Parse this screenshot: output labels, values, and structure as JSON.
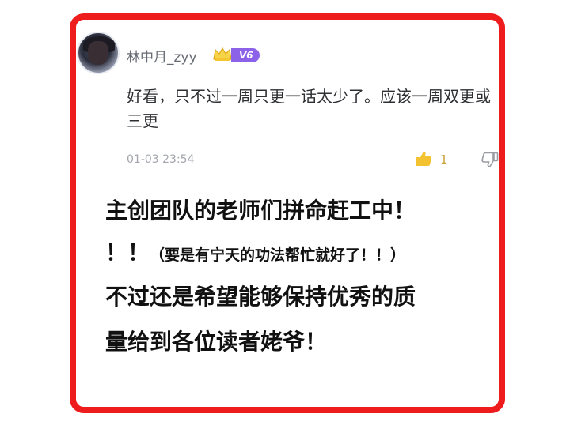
{
  "comment": {
    "user": {
      "name": "林中月_zyy",
      "level": "V6",
      "avatar_icon": "avatar",
      "crown_icon": "crown-icon"
    },
    "text": "好看，只不过一周只更一话太少了。应该一周双更或三更",
    "timestamp": "01-03 23:54",
    "likes": "1",
    "like_icon": "thumbs-up-icon",
    "dislike_icon": "thumbs-down-icon"
  },
  "caption": {
    "line1": "主创团队的老师们拼命赶工中！",
    "line2_a": "！！",
    "line2_b": "（要是有宁天的功法帮忙就好了！！）",
    "line3": "不过还是希望能够保持优秀的质",
    "line4": "量给到各位读者姥爷！"
  },
  "colors": {
    "frame": "#ee1c1c",
    "level_badge": "#8b62e8",
    "like": "#f2c230"
  }
}
